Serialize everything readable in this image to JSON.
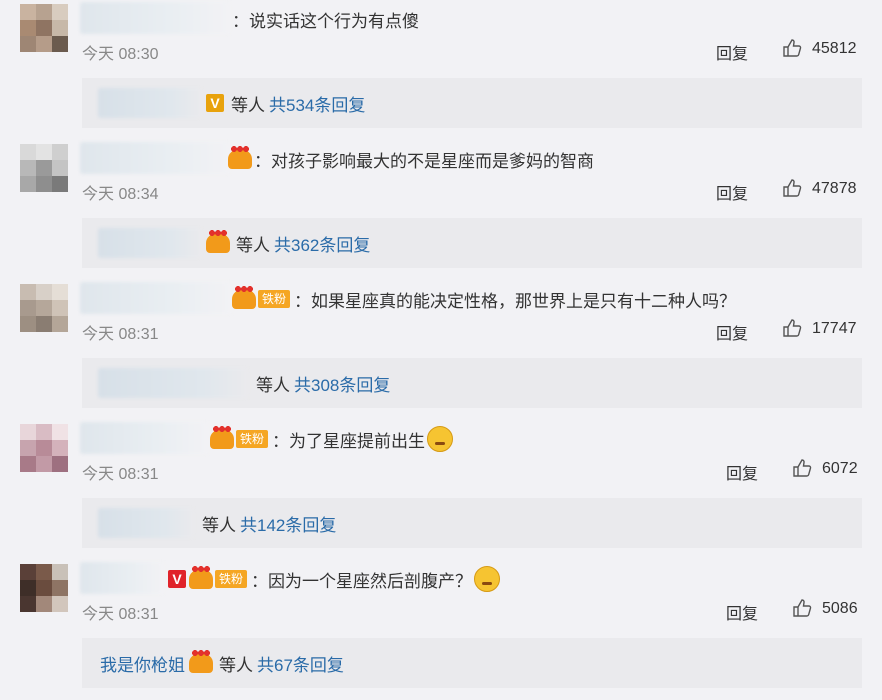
{
  "colors": {
    "link": "#2a6ba8",
    "page_bg": "#f2f2f5",
    "reply_bg": "#eaeaed"
  },
  "comments": [
    {
      "text": "：说实话这个行为有点傻",
      "time": "今天 08:30",
      "reply": "回复",
      "likes": "45812",
      "reply_summary": {
        "others": "等人",
        "count": "共534条回复",
        "name": ""
      },
      "badges": []
    },
    {
      "text": "：对孩子影响最大的不是星座而是爹妈的智商",
      "time": "今天 08:34",
      "reply": "回复",
      "likes": "47878",
      "reply_summary": {
        "others": "等人",
        "count": "共362条回复",
        "name": ""
      },
      "badges": [
        "crown-icon"
      ]
    },
    {
      "text": "：如果星座真的能决定性格，那世界上是只有十二种人吗？",
      "time": "今天 08:31",
      "reply": "回复",
      "likes": "17747",
      "reply_summary": {
        "others": "等人",
        "count": "共308条回复",
        "name": ""
      },
      "badges": [
        "crown-icon",
        "tiefen-badge"
      ],
      "tiefen": "铁粉"
    },
    {
      "text": "：为了星座提前出生",
      "time": "今天 08:31",
      "reply": "回复",
      "likes": "6072",
      "reply_summary": {
        "others": "等人",
        "count": "共142条回复",
        "name": ""
      },
      "badges": [
        "crown-icon",
        "tiefen-badge"
      ],
      "tiefen": "铁粉",
      "emoji": "sweat-emoji-icon"
    },
    {
      "text": "：因为一个星座然后剖腹产？",
      "time": "今天 08:31",
      "reply": "回复",
      "likes": "5086",
      "reply_summary": {
        "others": "等人",
        "count": "共67条回复",
        "name": "我是你枪姐"
      },
      "badges": [
        "v-badge",
        "crown-icon",
        "tiefen-badge"
      ],
      "tiefen": "铁粉",
      "emoji": "dizzy-emoji-icon"
    }
  ]
}
